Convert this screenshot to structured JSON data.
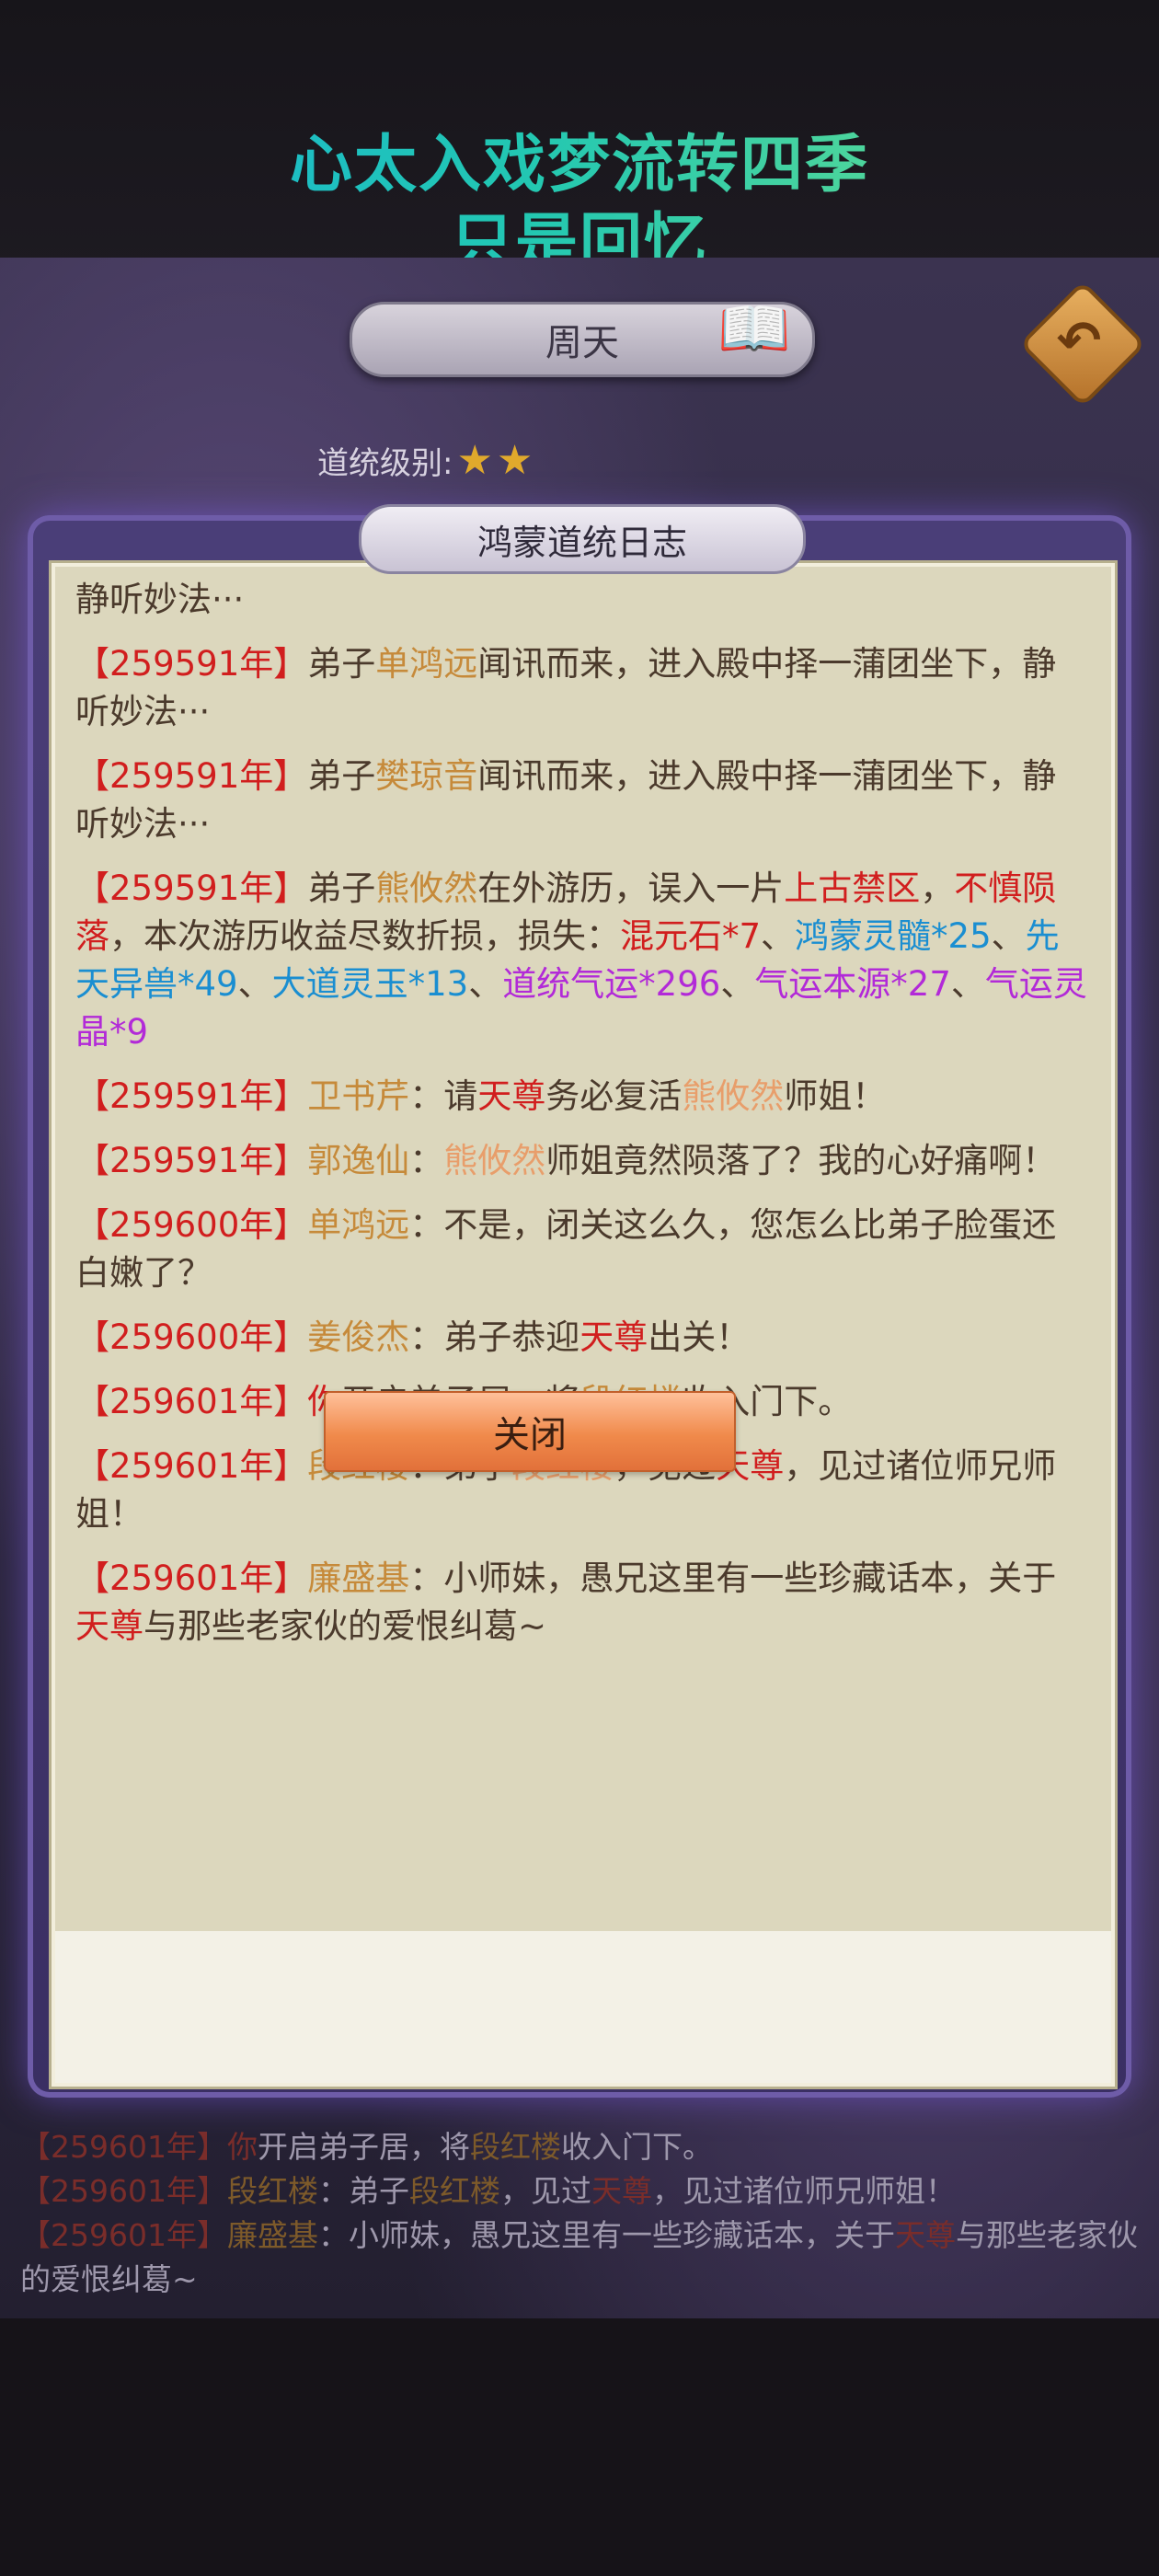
{
  "banner": {
    "line1": "心太入戏梦流转四季",
    "line2": "只是回忆"
  },
  "header": {
    "title": "周天",
    "back_icon": "back-arrow-icon",
    "book_icon": "book-quill-icon"
  },
  "status": {
    "level_label": "道统级别:",
    "stars": 2
  },
  "modal": {
    "title": "鸿蒙道统日志",
    "close_label": "关闭",
    "top_partial": "静听妙法···",
    "entries": [
      {
        "year": "【259591年】",
        "text_a": "弟子",
        "name": "单鸿远",
        "text_b": "闻讯而来，进入殿中择一蒲团坐下，静听妙法···"
      },
      {
        "year": "【259591年】",
        "text_a": "弟子",
        "name": "樊琼音",
        "text_b": "闻讯而来，进入殿中择一蒲团坐下，静听妙法···"
      },
      {
        "year": "【259591年】",
        "text_a": "弟子",
        "name": "熊攸然",
        "text_b": "在外游历，误入一片",
        "place": "上古禁区",
        "comma": "，",
        "danger": "不慎陨落",
        "text_c": "，本次游历收益尽数折损，损失：",
        "loss1": "混元石*7",
        "sep": "、",
        "loss2": "鸿蒙灵髓*25",
        "loss3": "先天异兽*49",
        "loss4": "大道灵玉*13",
        "loss5": "道统气运*296",
        "loss6": "气运本源*27",
        "loss7": "气运灵晶*9"
      },
      {
        "year": "【259591年】",
        "name": "卫书芹",
        "text_a": "：请",
        "title": "天尊",
        "text_b": "务必复活",
        "name2": "熊攸然",
        "text_c": "师姐！"
      },
      {
        "year": "【259591年】",
        "name": "郭逸仙",
        "text_a": "：",
        "name2": "熊攸然",
        "text_b": "师姐竟然陨落了？我的心好痛啊！"
      },
      {
        "year": "【259600年】",
        "name": "单鸿远",
        "text_a": "：不是，闭关这么久，您怎么比弟子脸蛋还白嫩了？"
      },
      {
        "year": "【259600年】",
        "name": "姜俊杰",
        "text_a": "：弟子恭迎",
        "title": "天尊",
        "text_b": "出关！"
      },
      {
        "year": "【259601年】",
        "you": "你",
        "text_a": "开启弟子居，将",
        "name": "段红楼",
        "text_b": "收入门下。"
      },
      {
        "year": "【259601年】",
        "name": "段红楼",
        "text_a": "：弟子",
        "name2": "段红楼",
        "text_b": "，见过",
        "title": "天尊",
        "text_c": "，见过诸位师兄师姐！"
      },
      {
        "year": "【259601年】",
        "name": "廉盛基",
        "text_a": "：小师妹，愚兄这里有一些珍藏话本，关于",
        "title": "天尊",
        "text_b": "与那些老家伙的爱恨纠葛~"
      }
    ]
  },
  "background_log": [
    {
      "year": "【259601年】",
      "you": "你",
      "text_a": "开启弟子居，将",
      "name": "段红楼",
      "text_b": "收入门下。"
    },
    {
      "year": "【259601年】",
      "name": "段红楼",
      "text_a": "：弟子",
      "name2": "段红楼",
      "text_b": "，见过",
      "title": "天尊",
      "text_c": "，见过诸位师兄师姐！"
    },
    {
      "year": "【259601年】",
      "name": "廉盛基",
      "text_a": "：小师妹，愚兄这里有一些珍藏话本，关于",
      "title": "天尊",
      "text_b": "与那些老家伙的爱恨纠葛~"
    }
  ]
}
